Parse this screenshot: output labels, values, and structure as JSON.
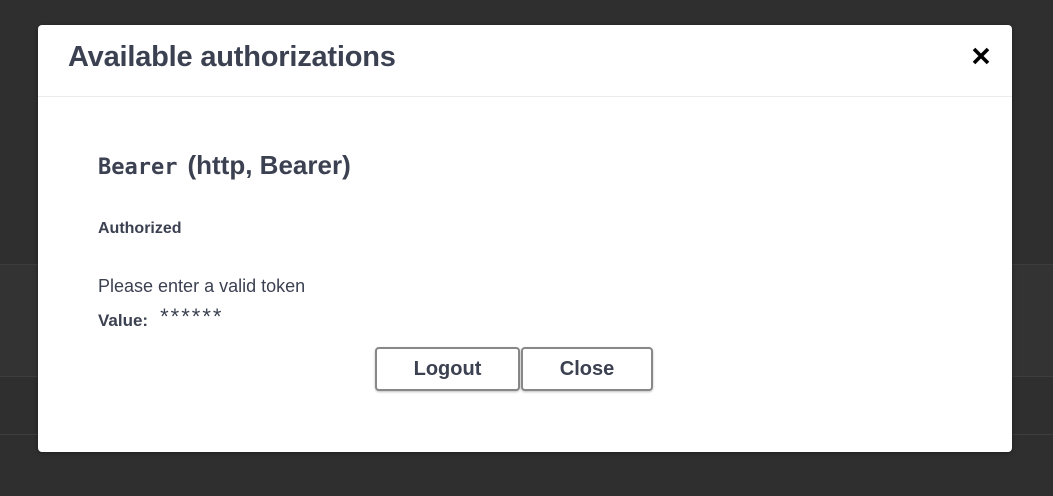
{
  "modal": {
    "title": "Available authorizations",
    "close_icon": "close-icon"
  },
  "auth": {
    "scheme_name": "Bearer",
    "scheme_type": "(http, Bearer)",
    "status": "Authorized",
    "hint": "Please enter a valid token",
    "value_label": "Value:",
    "value": "******"
  },
  "buttons": {
    "logout_label": "Logout",
    "close_label": "Close"
  },
  "colors": {
    "text": "#3b4151",
    "backdrop": "#2f2f2f",
    "modal_bg": "#ffffff",
    "button_border": "#888888"
  }
}
